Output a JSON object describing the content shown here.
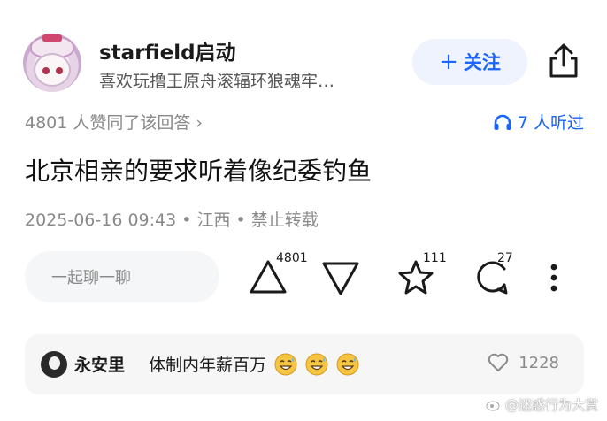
{
  "author": {
    "name": "starfield启动",
    "bio": "喜欢玩撸王原舟滚辐环狼魂牢…"
  },
  "follow_button": {
    "plus": "+",
    "label": "关注"
  },
  "agree_text": "4801 人赞同了该回答 ›",
  "listen_text": "7 人听过",
  "answer_title": "北京相亲的要求听着像纪委钓鱼",
  "post_info": "2025-06-16 09:43 • 江西 • 禁止转载",
  "comment_placeholder": "一起聊一聊",
  "actions": {
    "upvote_count": "4801",
    "favorite_count": "111",
    "comment_count": "27"
  },
  "hot_comment": {
    "user": "永安里",
    "text": "体制内年薪百万",
    "emoji": [
      "grin-sweat-emoji",
      "grin-sweat-emoji",
      "grin-sweat-emoji"
    ],
    "like_count": "1228"
  },
  "watermark": "@迷惑行为大赏",
  "colors": {
    "accent": "#1a66ff",
    "muted": "#8a8a8a",
    "panel": "#f6f6f7"
  }
}
